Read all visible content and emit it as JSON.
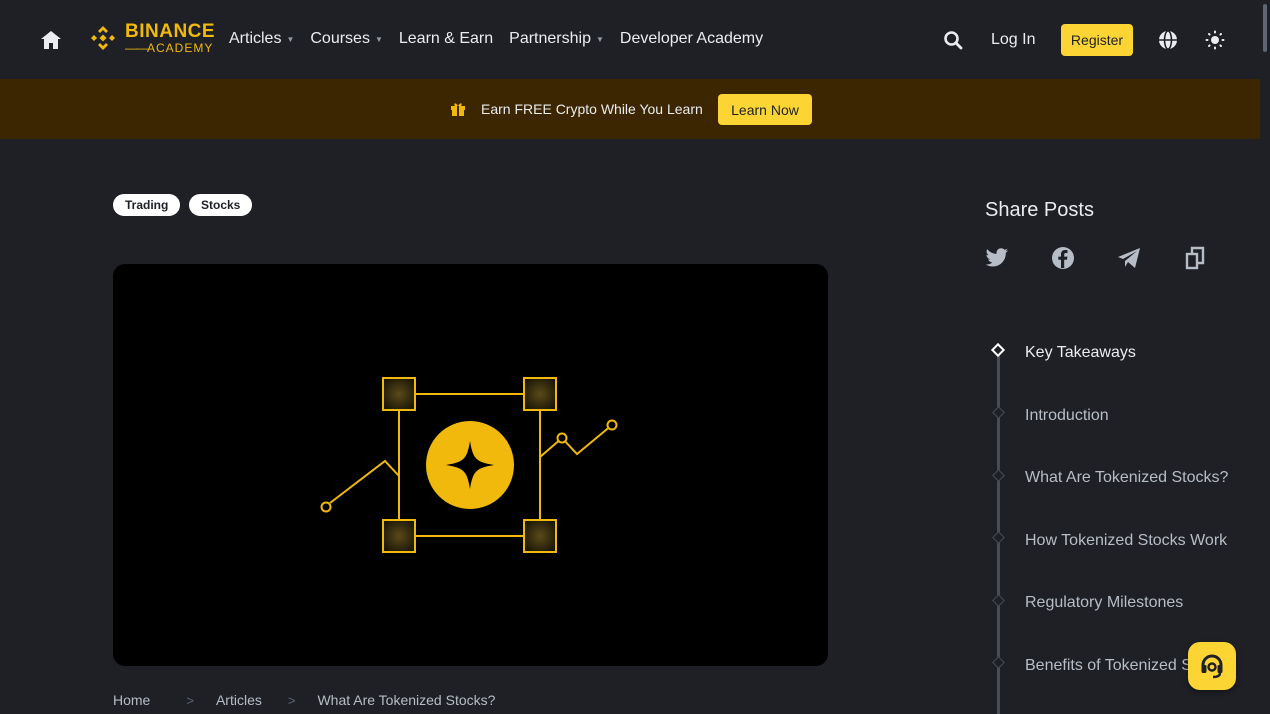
{
  "header": {
    "logo": {
      "line1": "BINANCE",
      "line2": "ACADEMY"
    },
    "nav": [
      {
        "label": "Articles",
        "dropdown": true
      },
      {
        "label": "Courses",
        "dropdown": true
      },
      {
        "label": "Learn & Earn",
        "dropdown": false
      },
      {
        "label": "Partnership",
        "dropdown": true
      },
      {
        "label": "Developer Academy",
        "dropdown": false
      }
    ],
    "login_label": "Log In",
    "register_label": "Register",
    "icons": [
      "home-icon",
      "search-icon",
      "globe-icon",
      "theme-toggle-icon"
    ]
  },
  "promo": {
    "text": "Earn FREE Crypto While You Learn",
    "cta_label": "Learn Now",
    "icon": "gift-icon"
  },
  "tags": [
    "Trading",
    "Stocks"
  ],
  "breadcrumb": [
    "Home",
    "Articles",
    "What Are Tokenized Stocks?"
  ],
  "share": {
    "title": "Share Posts",
    "icons": [
      "twitter-icon",
      "facebook-icon",
      "telegram-icon",
      "copy-link-icon"
    ]
  },
  "toc": {
    "active_index": 0,
    "items": [
      "Key Takeaways",
      "Introduction",
      "What Are Tokenized Stocks?",
      "How Tokenized Stocks Work",
      "Regulatory Milestones",
      "Benefits of Tokenized S"
    ]
  },
  "colors": {
    "background": "#1e2026",
    "accent": "#fcd535",
    "promo_bg": "#3c2601",
    "brand_gold": "#f0b90b"
  }
}
